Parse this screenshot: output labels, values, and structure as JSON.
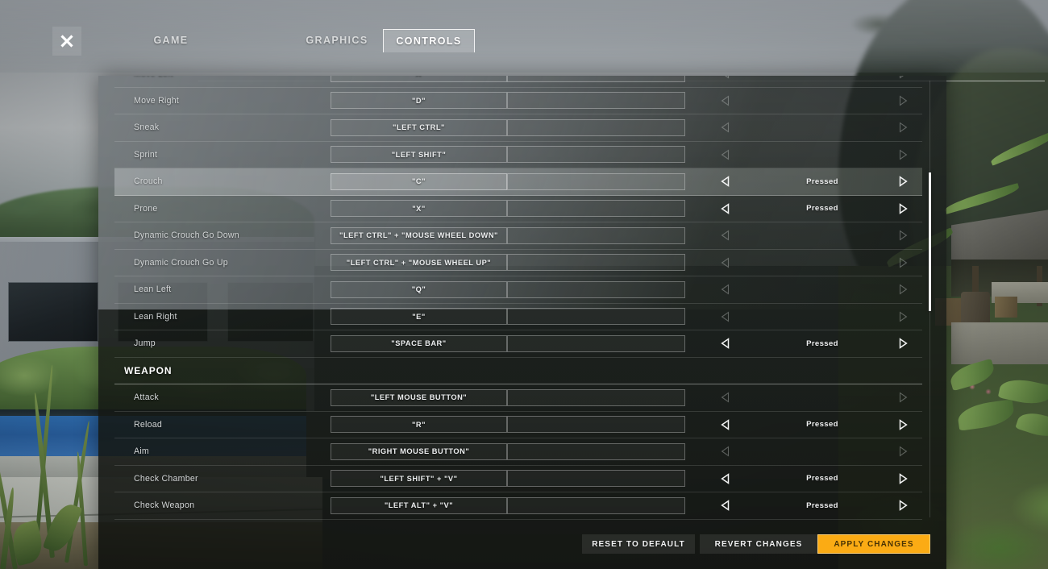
{
  "window": {
    "close_icon": "close-icon"
  },
  "tabs": [
    {
      "id": "game",
      "label": "GAME",
      "active": false
    },
    {
      "id": "graphics",
      "label": "GRAPHICS",
      "active": false
    },
    {
      "id": "controls",
      "label": "CONTROLS",
      "active": true
    }
  ],
  "icons": {
    "arrow_left": "triangle-left-icon",
    "arrow_right": "triangle-right-icon"
  },
  "colors": {
    "accent": "#fbab14",
    "accent_text": "#4a3405",
    "row_text": "#d3d6d7",
    "bind_text": "#eceeef",
    "selected_row": "#e6eaec"
  },
  "rows": [
    {
      "type": "row",
      "label": "Move Left",
      "primary": "\"A\"",
      "secondary": "",
      "state": "",
      "selected": false,
      "arrows_active": false
    },
    {
      "type": "row",
      "label": "Move Right",
      "primary": "\"D\"",
      "secondary": "",
      "state": "",
      "selected": false,
      "arrows_active": false
    },
    {
      "type": "row",
      "label": "Sneak",
      "primary": "\"LEFT CTRL\"",
      "secondary": "",
      "state": "",
      "selected": false,
      "arrows_active": false
    },
    {
      "type": "row",
      "label": "Sprint",
      "primary": "\"LEFT SHIFT\"",
      "secondary": "",
      "state": "",
      "selected": false,
      "arrows_active": false
    },
    {
      "type": "row",
      "label": "Crouch",
      "primary": "\"C\"",
      "secondary": "",
      "state": "Pressed",
      "selected": true,
      "arrows_active": true
    },
    {
      "type": "row",
      "label": "Prone",
      "primary": "\"X\"",
      "secondary": "",
      "state": "Pressed",
      "selected": false,
      "arrows_active": true
    },
    {
      "type": "row",
      "label": "Dynamic Crouch Go Down",
      "primary": "\"LEFT CTRL\" + \"MOUSE WHEEL DOWN\"",
      "secondary": "",
      "state": "",
      "selected": false,
      "arrows_active": false
    },
    {
      "type": "row",
      "label": "Dynamic Crouch Go Up",
      "primary": "\"LEFT CTRL\" + \"MOUSE WHEEL UP\"",
      "secondary": "",
      "state": "",
      "selected": false,
      "arrows_active": false
    },
    {
      "type": "row",
      "label": "Lean Left",
      "primary": "\"Q\"",
      "secondary": "",
      "state": "",
      "selected": false,
      "arrows_active": false
    },
    {
      "type": "row",
      "label": "Lean Right",
      "primary": "\"E\"",
      "secondary": "",
      "state": "",
      "selected": false,
      "arrows_active": false
    },
    {
      "type": "row",
      "label": "Jump",
      "primary": "\"SPACE BAR\"",
      "secondary": "",
      "state": "Pressed",
      "selected": false,
      "arrows_active": true
    },
    {
      "type": "section",
      "label": "WEAPON"
    },
    {
      "type": "row",
      "label": "Attack",
      "primary": "\"LEFT MOUSE BUTTON\"",
      "secondary": "",
      "state": "",
      "selected": false,
      "arrows_active": false
    },
    {
      "type": "row",
      "label": "Reload",
      "primary": "\"R\"",
      "secondary": "",
      "state": "Pressed",
      "selected": false,
      "arrows_active": true
    },
    {
      "type": "row",
      "label": "Aim",
      "primary": "\"RIGHT MOUSE BUTTON\"",
      "secondary": "",
      "state": "",
      "selected": false,
      "arrows_active": false
    },
    {
      "type": "row",
      "label": "Check Chamber",
      "primary": "\"LEFT SHIFT\" + \"V\"",
      "secondary": "",
      "state": "Pressed",
      "selected": false,
      "arrows_active": true
    },
    {
      "type": "row",
      "label": "Check Weapon",
      "primary": "\"LEFT ALT\" + \"V\"",
      "secondary": "",
      "state": "Pressed",
      "selected": false,
      "arrows_active": true
    }
  ],
  "footer": {
    "reset_label": "RESET TO DEFAULT",
    "revert_label": "REVERT CHANGES",
    "apply_label": "APPLY CHANGES"
  }
}
